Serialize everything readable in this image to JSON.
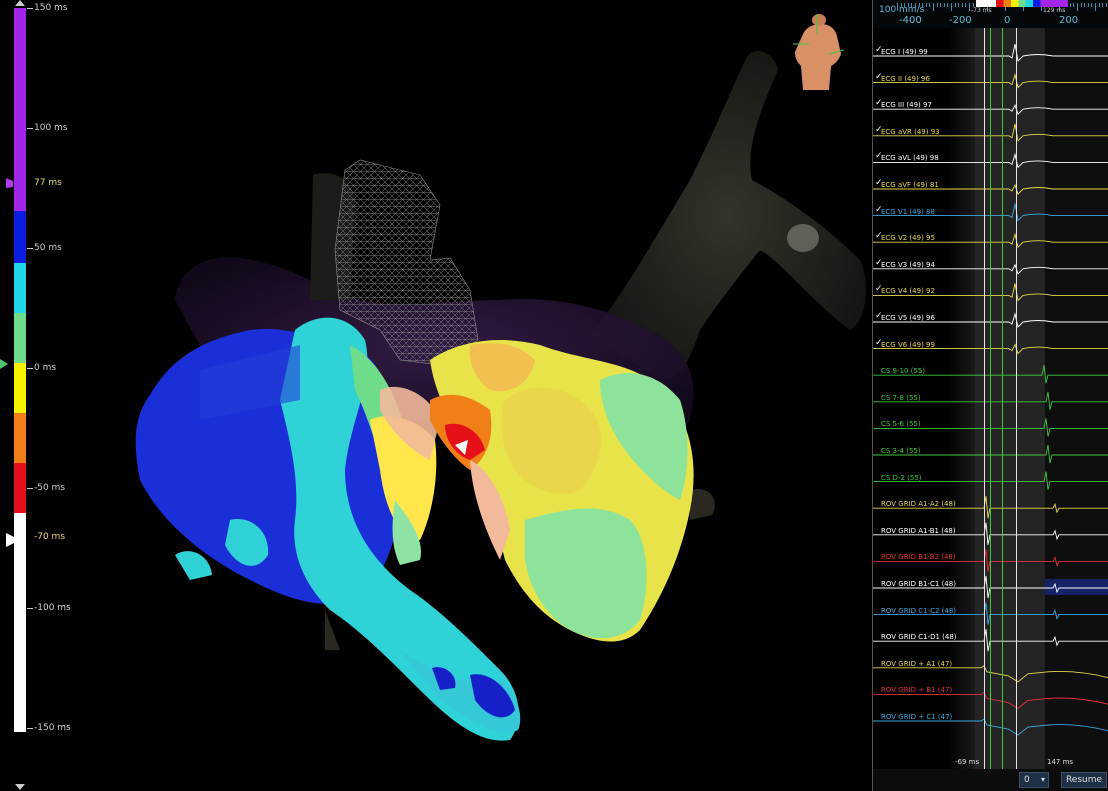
{
  "scale": {
    "labels": {
      "top": "150 ms",
      "t100": "100 ms",
      "t77": "77 ms",
      "t50": "50 ms",
      "t0": "0 ms",
      "tm50": "-50 ms",
      "tm70": "-70 ms",
      "tm100": "-100 ms",
      "bottom": "-150 ms"
    },
    "colors": [
      "#a326e8",
      "#0a1fe0",
      "#1fd5e8",
      "#6fdc8a",
      "#f7f200",
      "#f07f18",
      "#e5101a",
      "#ffffff"
    ]
  },
  "ruler": {
    "speed": "100 mm/s",
    "ticks": [
      "-400",
      "-200",
      "0",
      "200"
    ],
    "colorbar_left": "-73 ms",
    "colorbar_right": "129 ms"
  },
  "traces": [
    {
      "label": "ECG I (49)  99",
      "color": "#ffffff",
      "checked": true
    },
    {
      "label": "ECG II (49)  96",
      "color": "#e8d84a",
      "checked": true
    },
    {
      "label": "ECG III (49)  97",
      "color": "#ffffff",
      "checked": true
    },
    {
      "label": "ECG aVR (49)  93",
      "color": "#e8d84a",
      "checked": true
    },
    {
      "label": "ECG aVL (49)  98",
      "color": "#ffffff",
      "checked": true
    },
    {
      "label": "ECG aVF (49)  81",
      "color": "#e8d84a",
      "checked": true
    },
    {
      "label": "ECG V1 (49)  88",
      "color": "#39a8e0",
      "checked": true
    },
    {
      "label": "ECG V2 (49)  95",
      "color": "#e8d84a",
      "checked": true
    },
    {
      "label": "ECG V3 (49)  94",
      "color": "#ffffff",
      "checked": true
    },
    {
      "label": "ECG V4 (49)  92",
      "color": "#e8d84a",
      "checked": true
    },
    {
      "label": "ECG V5 (49)  96",
      "color": "#ffffff",
      "checked": true
    },
    {
      "label": "ECG V6 (49)  99",
      "color": "#e8d84a",
      "checked": true
    },
    {
      "label": "CS  9-10 (55)",
      "color": "#3ec93e",
      "checked": false
    },
    {
      "label": "CS  7-8 (55)",
      "color": "#3ec93e",
      "checked": false
    },
    {
      "label": "CS  5-6 (55)",
      "color": "#3ec93e",
      "checked": false
    },
    {
      "label": "CS  3-4 (55)",
      "color": "#3ec93e",
      "checked": false
    },
    {
      "label": "CS  D-2 (55)",
      "color": "#3ec93e",
      "checked": false
    },
    {
      "label": "ROV GRID   A1-A2 (48)",
      "color": "#e8d84a",
      "checked": false
    },
    {
      "label": "ROV GRID   A1-B1 (48)",
      "color": "#ffffff",
      "checked": false
    },
    {
      "label": "ROV GRID   B1-B2 (48)",
      "color": "#e5323a",
      "checked": false
    },
    {
      "label": "ROV GRID   B1-C1 (48)",
      "color": "#ffffff",
      "checked": false
    },
    {
      "label": "ROV GRID   C1-C2 (48)",
      "color": "#39a8e0",
      "checked": false
    },
    {
      "label": "ROV GRID   C1-D1 (48)",
      "color": "#ffffff",
      "checked": false
    },
    {
      "label": "ROV GRID + A1 (47)",
      "color": "#e8d84a",
      "checked": false
    },
    {
      "label": "ROV GRID + B1 (47)",
      "color": "#e5323a",
      "checked": false
    },
    {
      "label": "ROV GRID + C1 (47)",
      "color": "#39a8e0",
      "checked": false
    }
  ],
  "measurements": {
    "left": "-69 ms",
    "right": "147 ms"
  },
  "controls": {
    "dropdown_value": "0",
    "resume_label": "Resume"
  }
}
